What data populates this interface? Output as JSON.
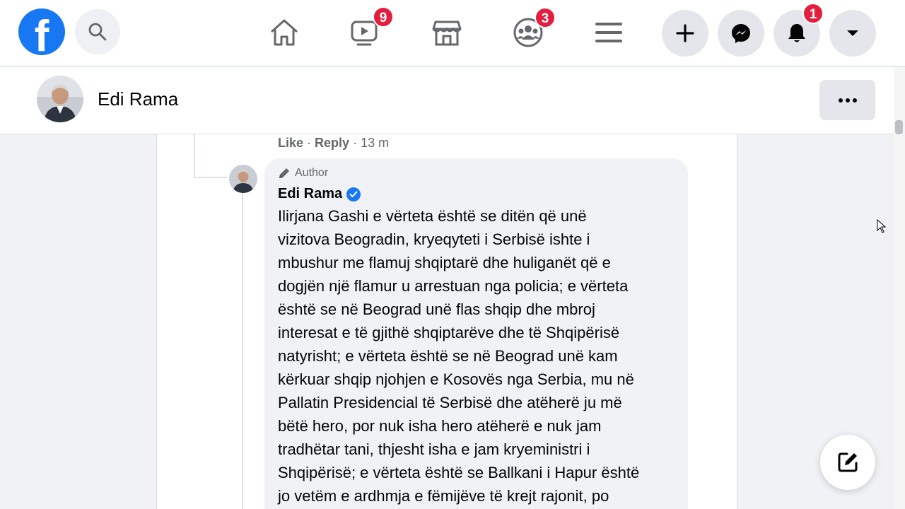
{
  "topbar": {
    "logo_icon": "facebook-logo",
    "search_icon": "search-icon",
    "nav": [
      {
        "name": "home",
        "icon": "home-icon",
        "badge": ""
      },
      {
        "name": "watch",
        "icon": "video-icon",
        "badge": "9"
      },
      {
        "name": "marketplace",
        "icon": "store-icon",
        "badge": ""
      },
      {
        "name": "groups",
        "icon": "groups-icon",
        "badge": "3"
      },
      {
        "name": "menu",
        "icon": "menu-icon",
        "badge": ""
      }
    ],
    "right": [
      {
        "name": "create",
        "icon": "plus-icon",
        "badge": ""
      },
      {
        "name": "messenger",
        "icon": "messenger-icon",
        "badge": ""
      },
      {
        "name": "notifications",
        "icon": "bell-icon",
        "badge": "1"
      },
      {
        "name": "account",
        "icon": "caret-down-icon",
        "badge": ""
      }
    ]
  },
  "profile": {
    "name": "Edi Rama"
  },
  "previous_comment": {
    "like": "Like",
    "reply": "Reply",
    "time": "13 m"
  },
  "comment": {
    "author_tag": "Author",
    "name": "Edi Rama",
    "lines": [
      "Ilirjana Gashi e vërteta është se ditën që unë",
      "vizitova Beogradin, kryeqyteti i Serbisë ishte i",
      "mbushur me flamuj shqiptarë dhe huliganët që e",
      "dogjën një flamur u arrestuan nga policia; e vërteta",
      "është se në Beograd unë flas shqip dhe mbroj",
      "interesat e të gjithë shqiptarëve dhe të Shqipërisë",
      "natyrisht; e vërteta është se në Beograd unë kam",
      "kërkuar shqip njohjen e Kosovës nga Serbia, mu në",
      "Pallatin Presidencial të Serbisë dhe atëherë ju më",
      "bëtë hero, por nuk isha hero atëherë e nuk jam",
      "tradhëtar tani, thjesht isha e jam kryeministri i",
      "Shqipërisë; e vërteta është se Ballkani i Hapur është",
      "jo vetëm e ardhmja e fëmijëve të krejt rajonit, po"
    ]
  },
  "colors": {
    "brand": "#1877f2",
    "badge": "#e41e3f",
    "bubble": "#f0f2f5"
  }
}
